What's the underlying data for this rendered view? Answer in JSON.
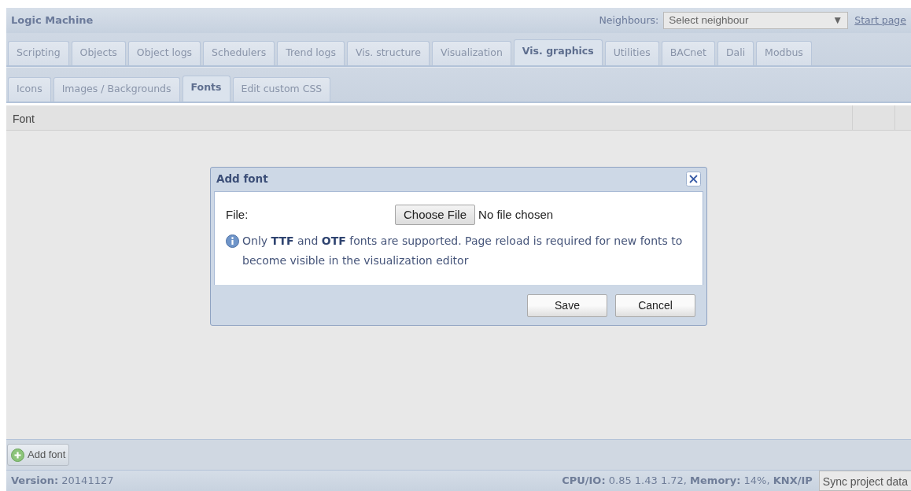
{
  "header": {
    "title": "Logic Machine",
    "neighbours_label": "Neighbours:",
    "neighbour_select": {
      "value": "Select neighbour",
      "arrow": "▼"
    },
    "start_page_link": "Start page"
  },
  "tabs": [
    {
      "label": "Scripting",
      "selected": false
    },
    {
      "label": "Objects",
      "selected": false
    },
    {
      "label": "Object logs",
      "selected": false
    },
    {
      "label": "Schedulers",
      "selected": false
    },
    {
      "label": "Trend logs",
      "selected": false
    },
    {
      "label": "Vis. structure",
      "selected": false
    },
    {
      "label": "Visualization",
      "selected": false
    },
    {
      "label": "Vis. graphics",
      "selected": true
    },
    {
      "label": "Utilities",
      "selected": false
    },
    {
      "label": "BACnet",
      "selected": false
    },
    {
      "label": "Dali",
      "selected": false
    },
    {
      "label": "Modbus",
      "selected": false
    }
  ],
  "subtabs": [
    {
      "label": "Icons",
      "selected": false
    },
    {
      "label": "Images / Backgrounds",
      "selected": false
    },
    {
      "label": "Fonts",
      "selected": true
    },
    {
      "label": "Edit custom CSS",
      "selected": false
    }
  ],
  "table": {
    "columns": [
      "Font"
    ]
  },
  "dialog": {
    "title": "Add font",
    "file_label": "File:",
    "file_button": "Choose File",
    "file_status": "No file chosen",
    "info": "Only **TTF** and **OTF** fonts are supported. Page reload is required for new fonts to become visible in the visualization editor",
    "buttons": [
      "Save",
      "Cancel"
    ]
  },
  "toolbar": {
    "add_button": "Add font"
  },
  "status_bar": {
    "version": "**Version:** 20141127",
    "stats": "**CPU/IO:** 0.85 1.43 1.72, **Memory:** 14%, **KNX/IP**",
    "sync_button": "Sync project data"
  }
}
